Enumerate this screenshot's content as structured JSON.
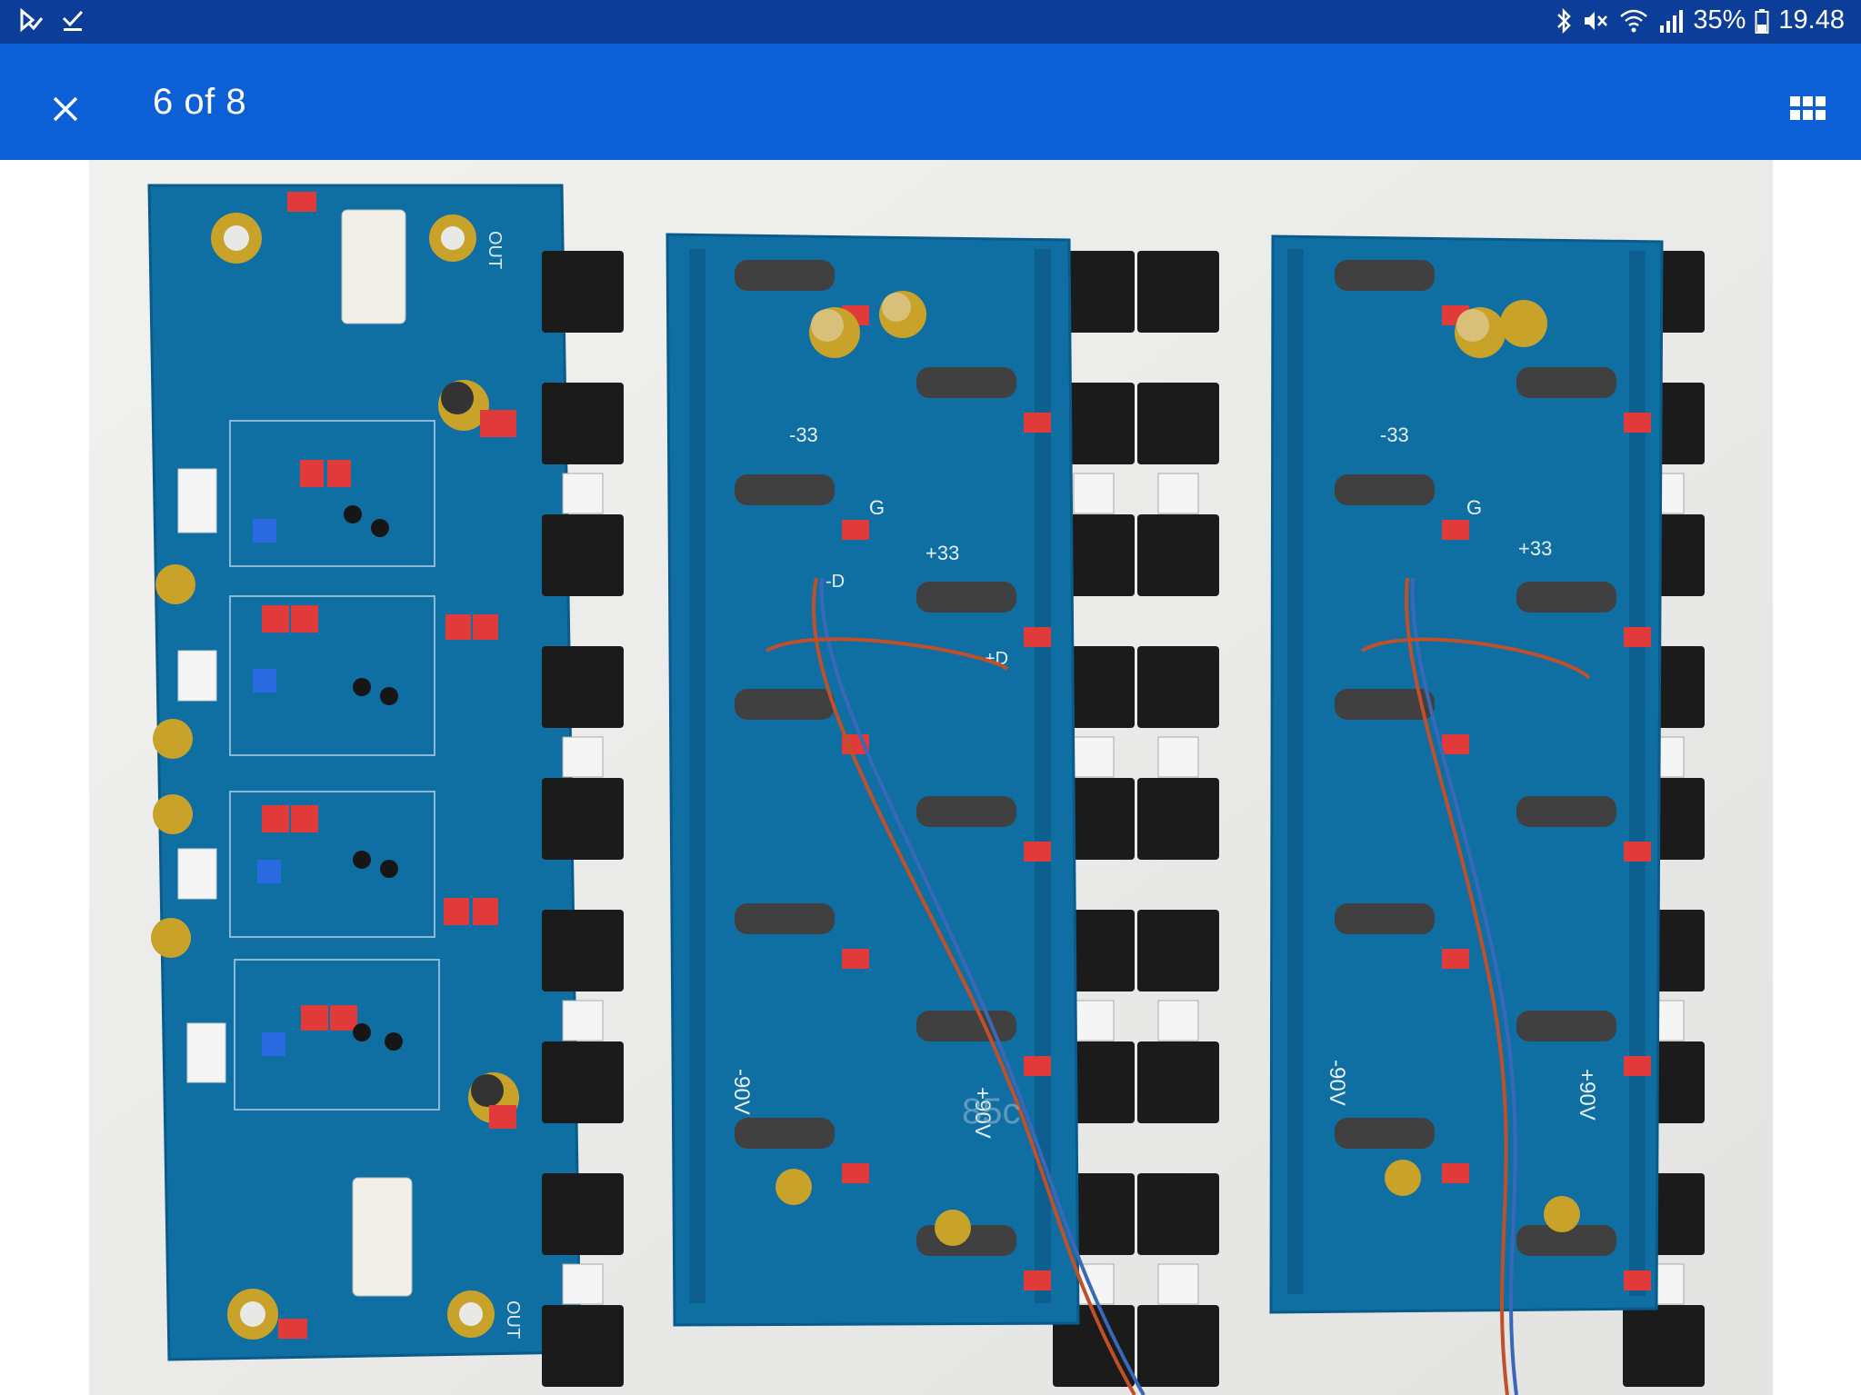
{
  "status_bar": {
    "left_icons": [
      "play-check-icon",
      "download-done-icon"
    ],
    "right_icons": [
      "bluetooth-icon",
      "mute-icon",
      "wifi-icon",
      "signal-icon",
      "battery-icon"
    ],
    "battery": "35%",
    "time": "19.48"
  },
  "app_bar": {
    "title": "6 of 8",
    "close_icon": "close-icon",
    "grid_icon": "grid-view-icon",
    "color": "#0d5fd6",
    "status_color": "#0b3d99"
  },
  "photo": {
    "description_labels": {
      "board_left_out_top": "OUT",
      "board_left_out_bottom": "OUT",
      "mid_minus33": "-33",
      "mid_plus33": "+33",
      "mid_G": "G",
      "mid_minusD": "-D",
      "mid_plusD": "+D",
      "mid_minus90": "-90V",
      "mid_plus90": "+90V",
      "right_minus33": "-33",
      "right_plus33": "+33",
      "right_G": "G",
      "right_minus90": "-90V",
      "right_plus90": "+90V",
      "watermark": "85c"
    },
    "colors": {
      "pcb": "#0f6fa3",
      "pcb_dark": "#0a5a8a",
      "transistor": "#1b1b1b",
      "resistor_body": "#444",
      "cap_gold": "#c9a22a",
      "relay": "#f2efe8",
      "red_part": "#e03a3a"
    }
  }
}
